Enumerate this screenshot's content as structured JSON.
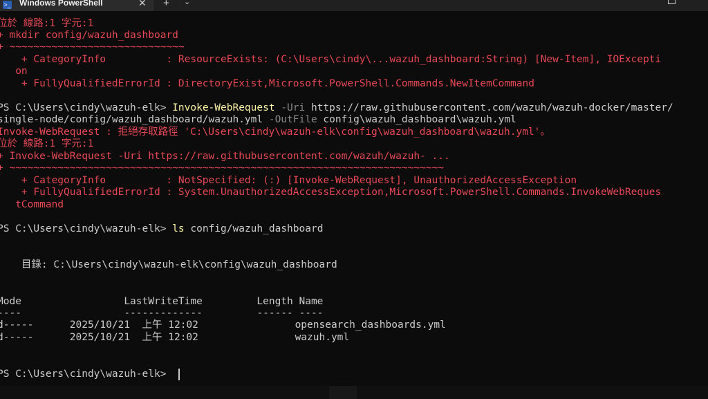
{
  "window": {
    "tab_title": "Windows PowerShell",
    "tab_close": "✕",
    "new_tab": "+",
    "tab_dropdown": "⌄",
    "ps_icon": ">_"
  },
  "colors": {
    "background": "#0c0c0c",
    "error": "#e74856",
    "command": "#f9f1a5",
    "parameter": "#8a8a8a",
    "text": "#cccccc"
  },
  "terminal": {
    "l01": "位於 線路:1 字元:1",
    "l02": "+ mkdir config/wazuh_dashboard",
    "l03": "+ ~~~~~~~~~~~~~~~~~~~~~~~~~~~~~",
    "l04": "    + CategoryInfo          : ResourceExists: (C:\\Users\\cindy\\...wazuh_dashboard:String) [New-Item], IOExcepti",
    "l05": "   on",
    "l06": "    + FullyQualifiedErrorId : DirectoryExist,Microsoft.PowerShell.Commands.NewItemCommand",
    "l07_prompt": "PS C:\\Users\\cindy\\wazuh-elk> ",
    "l07_cmd": "Invoke-WebRequest",
    "l07_p1": " -Uri",
    "l07_arg1": " https://raw.githubusercontent.com/wazuh/wazuh-docker/master/",
    "l08_arg": "single-node/config/wazuh_dashboard/wazuh.yml",
    "l08_p2": " -OutFile",
    "l08_arg2": " config\\wazuh_dashboard\\wazuh.yml",
    "l09": "Invoke-WebRequest : 拒絕存取路徑 'C:\\Users\\cindy\\wazuh-elk\\config\\wazuh_dashboard\\wazuh.yml'。",
    "l10": "位於 線路:1 字元:1",
    "l11": "+ Invoke-WebRequest -Uri https://raw.githubusercontent.com/wazuh/wazuh- ...",
    "l12": "+ ~~~~~~~~~~~~~~~~~~~~~~~~~~~~~~~~~~~~~~~~~~~~~~~~~~~~~~~~~~~~~~~~~~~~~~~~",
    "l13": "    + CategoryInfo          : NotSpecified: (:) [Invoke-WebRequest], UnauthorizedAccessException",
    "l14": "    + FullyQualifiedErrorId : System.UnauthorizedAccessException,Microsoft.PowerShell.Commands.InvokeWebReques",
    "l15": "   tCommand",
    "l16_prompt": "PS C:\\Users\\cindy\\wazuh-elk> ",
    "l16_cmd": "ls",
    "l16_arg": " config/wazuh_dashboard",
    "l17": "    目錄: C:\\Users\\cindy\\wazuh-elk\\config\\wazuh_dashboard",
    "l18": "Mode                 LastWriteTime         Length Name",
    "l19": "----                 -------------         ------ ----",
    "l20": "d-----      2025/10/21  上午 12:02                opensearch_dashboards.yml",
    "l21": "d-----      2025/10/21  上午 12:02                wazuh.yml",
    "l22_prompt": "PS C:\\Users\\cindy\\wazuh-elk> "
  }
}
